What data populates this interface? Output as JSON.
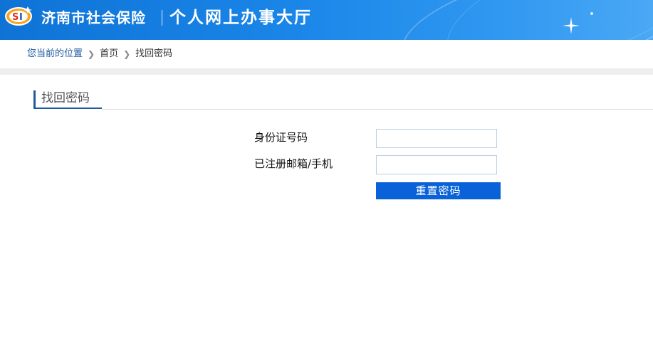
{
  "header": {
    "logo_icon": "social-insurance-logo-icon",
    "site_title": "济南市社会保险",
    "site_subtitle": "个人网上办事大厅",
    "colors": {
      "banner_start": "#0f73d6",
      "banner_end": "#4aa8f5"
    }
  },
  "breadcrumb": {
    "lead": "您当前的位置",
    "items": [
      "首页",
      "找回密码"
    ],
    "separator_icon": "chevron-right-icon"
  },
  "section": {
    "title": "找回密码"
  },
  "form": {
    "id_label": "身份证号码",
    "id_value": "",
    "contact_label": "已注册邮箱/手机",
    "contact_value": "",
    "submit_label": "重置密码",
    "colors": {
      "button": "#0a62d8",
      "accent": "#1f5a9e"
    }
  }
}
